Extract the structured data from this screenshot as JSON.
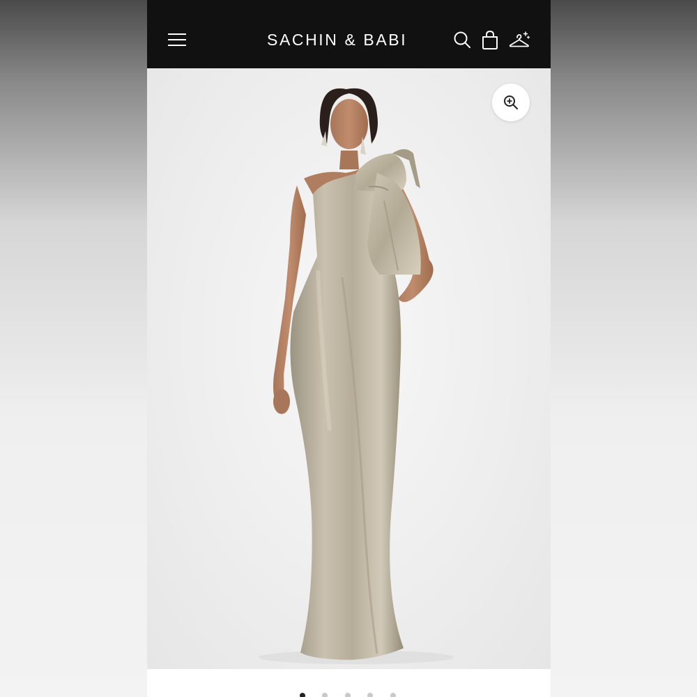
{
  "header": {
    "brand": "SACHIN & BABI",
    "icons": [
      "menu-icon",
      "search-icon",
      "bag-icon",
      "hanger-icon"
    ],
    "background_color": "#111111"
  },
  "hero": {
    "image_subject": "model-photo",
    "dress_color": "#b7ae9c",
    "zoom_icon": "zoom-in-icon"
  },
  "carousel": {
    "slide_count": 5,
    "active_index": 0
  }
}
